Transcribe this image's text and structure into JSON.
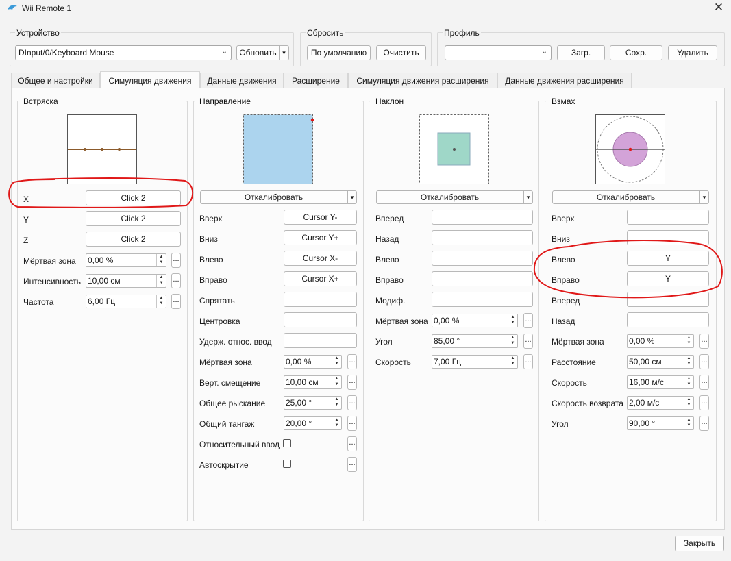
{
  "window": {
    "title": "Wii Remote 1",
    "close": "✕"
  },
  "device": {
    "group_label": "Устройство",
    "value": "DInput/0/Keyboard Mouse",
    "refresh": "Обновить"
  },
  "reset": {
    "group_label": "Сбросить",
    "default": "По умолчанию",
    "clear": "Очистить"
  },
  "profile": {
    "group_label": "Профиль",
    "value": "",
    "load": "Загр.",
    "save": "Сохр.",
    "delete": "Удалить"
  },
  "tabs": [
    {
      "label": "Общее и настройки"
    },
    {
      "label": "Симуляция движения"
    },
    {
      "label": "Данные движения"
    },
    {
      "label": "Расширение"
    },
    {
      "label": "Симуляция движения расширения"
    },
    {
      "label": "Данные движения расширения"
    }
  ],
  "active_tab": "Симуляция движения",
  "shake": {
    "title": "Встряска",
    "rows": [
      {
        "label": "X",
        "value": "Click 2"
      },
      {
        "label": "Y",
        "value": "Click 2"
      },
      {
        "label": "Z",
        "value": "Click 2"
      }
    ],
    "settings": [
      {
        "label": "Мёртвая зона",
        "value": "0,00 %"
      },
      {
        "label": "Интенсивность",
        "value": "10,00 см"
      },
      {
        "label": "Частота",
        "value": "6,00 Гц"
      }
    ]
  },
  "direction": {
    "title": "Направление",
    "calibrate": "Откалибровать",
    "rows": [
      {
        "label": "Вверх",
        "value": "Cursor Y-"
      },
      {
        "label": "Вниз",
        "value": "Cursor Y+"
      },
      {
        "label": "Влево",
        "value": "Cursor X-"
      },
      {
        "label": "Вправо",
        "value": "Cursor X+"
      },
      {
        "label": "Спрятать",
        "value": ""
      },
      {
        "label": "Центровка",
        "value": ""
      },
      {
        "label": "Удерж. относ. ввод",
        "value": ""
      }
    ],
    "settings": [
      {
        "label": "Мёртвая зона",
        "value": "0,00 %"
      },
      {
        "label": "Верт. смещение",
        "value": "10,00 см"
      },
      {
        "label": "Общее рыскание",
        "value": "25,00 °"
      },
      {
        "label": "Общий тангаж",
        "value": "20,00 °"
      }
    ],
    "checks": [
      {
        "label": "Относительный ввод",
        "checked": false
      },
      {
        "label": "Автоскрытие",
        "checked": false
      }
    ]
  },
  "tilt": {
    "title": "Наклон",
    "calibrate": "Откалибровать",
    "rows": [
      {
        "label": "Вперед",
        "value": ""
      },
      {
        "label": "Назад",
        "value": ""
      },
      {
        "label": "Влево",
        "value": ""
      },
      {
        "label": "Вправо",
        "value": ""
      },
      {
        "label": "Модиф.",
        "value": ""
      }
    ],
    "settings": [
      {
        "label": "Мёртвая зона",
        "value": "0,00 %"
      },
      {
        "label": "Угол",
        "value": "85,00 °"
      },
      {
        "label": "Скорость",
        "value": "7,00 Гц"
      }
    ]
  },
  "swing": {
    "title": "Взмах",
    "calibrate": "Откалибровать",
    "rows": [
      {
        "label": "Вверх",
        "value": ""
      },
      {
        "label": "Вниз",
        "value": ""
      },
      {
        "label": "Влево",
        "value": "Y"
      },
      {
        "label": "Вправо",
        "value": "Y"
      },
      {
        "label": "Вперед",
        "value": ""
      },
      {
        "label": "Назад",
        "value": ""
      }
    ],
    "settings": [
      {
        "label": "Мёртвая зона",
        "value": "0,00 %"
      },
      {
        "label": "Расстояние",
        "value": "50,00 см"
      },
      {
        "label": "Скорость",
        "value": "16,00 м/с"
      },
      {
        "label": "Скорость возврата",
        "value": "2,00 м/с"
      },
      {
        "label": "Угол",
        "value": "90,00 °"
      }
    ]
  },
  "footer": {
    "close": "Закрыть"
  },
  "common": {
    "dots": "...",
    "dropdown_arrow": "▾",
    "spin_up": "▲",
    "spin_down": "▼"
  },
  "colors": {
    "annotation": "#e01818",
    "direction_fill": "#acd4ee",
    "tilt_fill": "#9fd7c8",
    "swing_fill": "#d3a3d8"
  }
}
